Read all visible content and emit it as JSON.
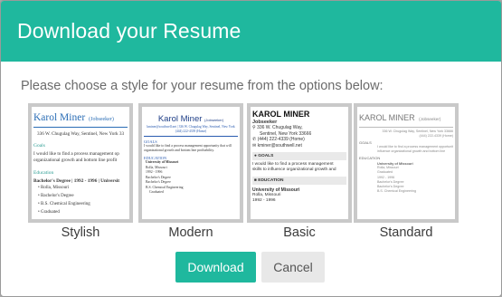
{
  "modal": {
    "title": "Download your Resume",
    "prompt": "Please choose a style for your resume from the options below:"
  },
  "styles": [
    {
      "label": "Stylish",
      "name": "Karol Miner",
      "role": "(Jobseeker)",
      "address": "336 W. Chugulag Way, Sentinel, New York 33",
      "goals_heading": "Goals",
      "goals_text": [
        "I would like to find a process management op",
        "organizational growth and bottom line profit"
      ],
      "education_heading": "Education",
      "degree": "Bachelor's Degree | 1992 - 1996 | Universit",
      "items": [
        "Rolla, Missouri",
        "Bachelor's Degree",
        "B.S. Chemical Engineering",
        "Graduated"
      ]
    },
    {
      "label": "Modern",
      "name": "Karol Miner",
      "role": "(Jobseeker)",
      "contact": [
        "kminer@southwell.net | 336 W. Chugulag Way, Sentinel, New York",
        "(444) 222-4339 (Home)"
      ],
      "goals_heading": "GOALS",
      "goals_text": [
        "I would like to find a process management opportunity that will",
        "organizational growth and bottom line profitability."
      ],
      "education_heading": "EDUCATION",
      "items": [
        "University of Missouri",
        "Rolla, Missouri",
        "1992 - 1996",
        "Bachelor's Degree",
        "Bachelor's Degree",
        "B.S. Chemical Engineering",
        "Graduated"
      ]
    },
    {
      "label": "Basic",
      "name": "KAROL MINER",
      "role": "Jobseeker",
      "lines": [
        "336 W. Chugulag Way,",
        "Sentinel, New York 33666",
        "(444) 222-4339 (Home)",
        "kminer@southwell.net"
      ],
      "goals_heading": "GOALS",
      "goals_text": [
        "I would like to find a process management",
        "skills to influence organizational growth and"
      ],
      "education_heading": "EDUCATION",
      "school": "University of Missouri",
      "items": [
        "Rolla, Missouri",
        "1992 - 1996"
      ]
    },
    {
      "label": "Standard",
      "name": "KAROL MINER",
      "role": "(Jobseeker)",
      "address": [
        "336 W. Chugulag Way, Sentinel, New York 33666",
        "(444) 222-4339 (Home)"
      ],
      "goals_heading": "GOALS",
      "goals_text": [
        "I would like to find a process management opportunity",
        "influence organizational growth and bottom line"
      ],
      "education_heading": "EDUCATION",
      "school": "University of Missouri",
      "items": [
        "Rolla, Missouri",
        "Graduated",
        "1992 - 1996",
        "Bachelor's Degree",
        "Bachelor's Degree",
        "B.S. Chemical Engineering"
      ]
    }
  ],
  "buttons": {
    "download": "Download",
    "cancel": "Cancel"
  },
  "colors": {
    "accent": "#1fb89e",
    "cancel_bg": "#e8e8e8",
    "thumb_border": "#c9c9c9",
    "stylish_blue": "#2a6db5"
  }
}
